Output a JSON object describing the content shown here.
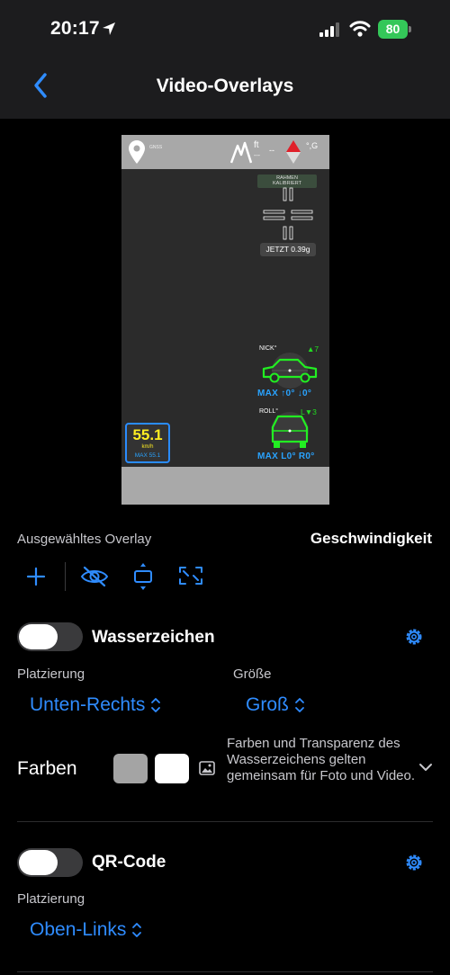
{
  "status": {
    "time": "20:17",
    "battery": "80"
  },
  "nav": {
    "title": "Video-Overlays",
    "back_icon": "chevron-left-icon"
  },
  "preview": {
    "gps_label": "GNSS",
    "altitude_unit": "ft",
    "altitude_value": "---",
    "heading_value": "--",
    "g_label": "°,G",
    "calibration_badge_line1": "RAHMEN",
    "calibration_badge_line2": "KALIBRIERT",
    "gforce_now": "JETZT 0.39g",
    "pitch_label": "NICK°",
    "pitch_value": "▲7",
    "pitch_max": "MAX ↑0° ↓0°",
    "roll_label": "ROLL°",
    "roll_value": "L▼3",
    "roll_max": "MAX L0° R0°",
    "speed_value": "55.1",
    "speed_unit": "km/h",
    "speed_max": "MAX 55.1"
  },
  "selected": {
    "label": "Ausgewähltes Overlay",
    "value": "Geschwindigkeit"
  },
  "toolbar": [
    "plus-icon",
    "eye-slash-icon",
    "resize-vertical-icon",
    "fullscreen-icon"
  ],
  "watermark": {
    "label": "Wasserzeichen",
    "enabled": false,
    "placement_label": "Platzierung",
    "placement_value": "Unten-Rechts",
    "size_label": "Größe",
    "size_value": "Groß",
    "colors_label": "Farben",
    "colors": [
      "#a4a4a4",
      "#ffffff"
    ],
    "colors_description": "Farben und Transparenz des Wasserzeichens gelten gemeinsam für Foto und Video."
  },
  "qrcode": {
    "label": "QR-Code",
    "enabled": false,
    "placement_label": "Platzierung",
    "placement_value": "Oben-Links"
  },
  "accent_color": "#2f8cff"
}
